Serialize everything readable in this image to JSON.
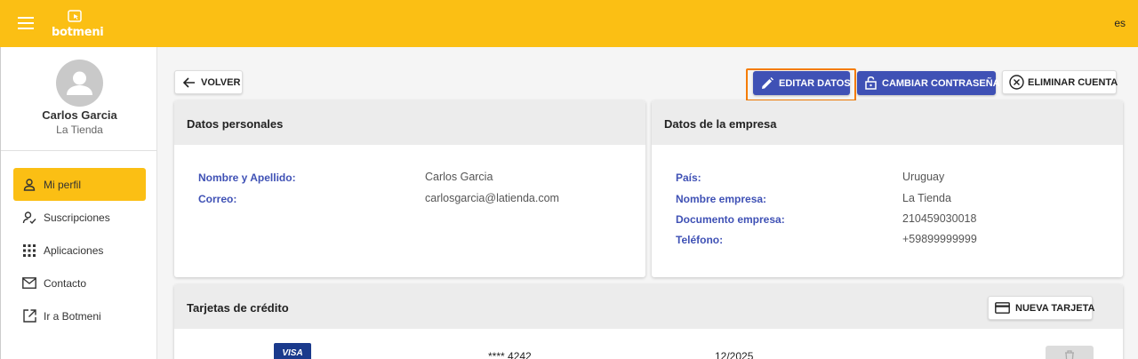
{
  "header": {
    "logo_text": "botmeni",
    "language": "es"
  },
  "sidebar": {
    "user_name": "Carlos Garcia",
    "user_company": "La Tienda",
    "items": [
      {
        "label": "Mi perfil",
        "icon": "person-icon",
        "active": true
      },
      {
        "label": "Suscripciones",
        "icon": "person-check-icon",
        "active": false
      },
      {
        "label": "Aplicaciones",
        "icon": "apps-grid-icon",
        "active": false
      },
      {
        "label": "Contacto",
        "icon": "mail-icon",
        "active": false
      },
      {
        "label": "Ir a Botmeni",
        "icon": "open-external-icon",
        "active": false
      }
    ]
  },
  "toolbar": {
    "back_label": "VOLVER",
    "edit_label": "EDITAR DATOS",
    "change_password_label": "CAMBIAR CONTRASEÑA",
    "delete_account_label": "ELIMINAR CUENTA"
  },
  "personal": {
    "title": "Datos personales",
    "fields": [
      {
        "label": "Nombre y Apellido:",
        "value": "Carlos Garcia"
      },
      {
        "label": "Correo:",
        "value": "carlosgarcia@latienda.com"
      }
    ]
  },
  "company": {
    "title": "Datos de la empresa",
    "fields": [
      {
        "label": "País:",
        "value": "Uruguay"
      },
      {
        "label": "Nombre empresa:",
        "value": "La Tienda"
      },
      {
        "label": "Documento empresa:",
        "value": "210459030018"
      },
      {
        "label": "Teléfono:",
        "value": "+59899999999"
      }
    ]
  },
  "cards_section": {
    "title": "Tarjetas de crédito",
    "new_card_label": "NUEVA TARJETA",
    "cards": [
      {
        "brand": "VISA",
        "number": "**** 4242",
        "expiry": "12/2025"
      }
    ]
  },
  "colors": {
    "brand_yellow": "#fbbf14",
    "accent_indigo": "#3f51b5",
    "focus_orange": "#f57c00"
  }
}
